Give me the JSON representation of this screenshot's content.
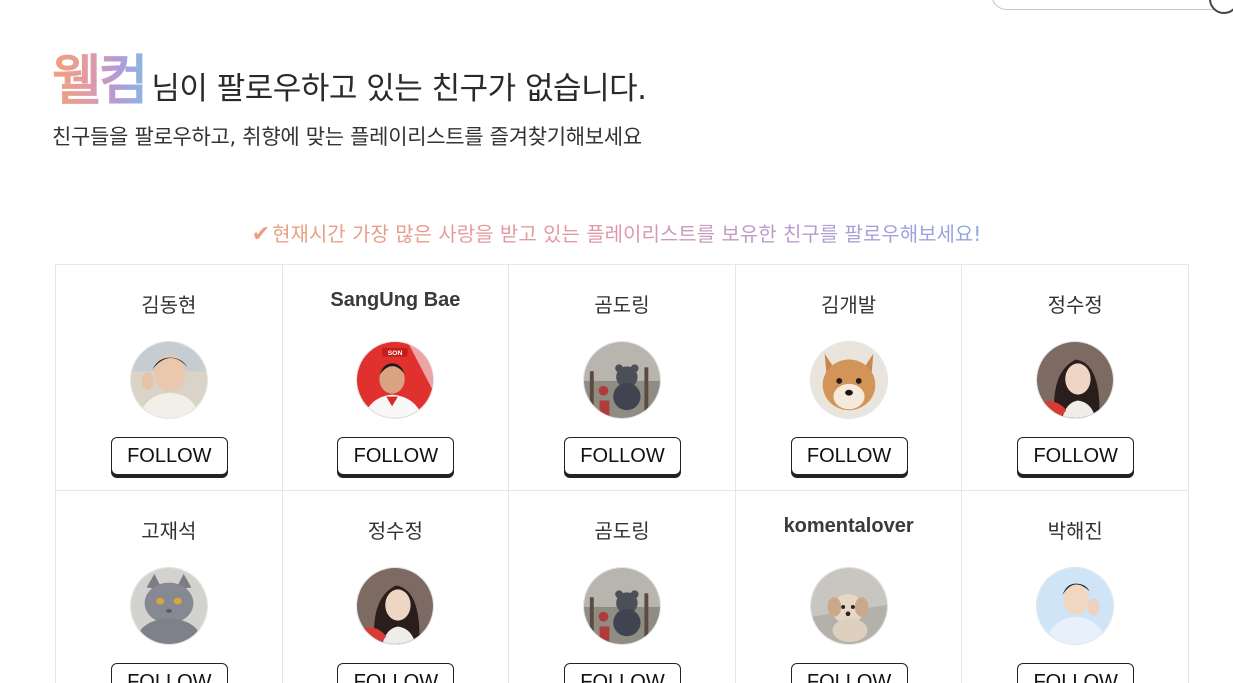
{
  "header": {
    "brand": "웰컴",
    "title_rest": "님이 팔로우하고 있는 친구가 없습니다.",
    "subtitle": "친구들을 팔로우하고, 취향에 맞는 플레이리스트를 즐겨찾기해보세요"
  },
  "recommend": {
    "check_icon": "✔",
    "text": "현재시간 가장 많은 사랑을 받고 있는 플레이리스트를 보유한 친구를 팔로우해보세요!"
  },
  "follow_label": "FOLLOW",
  "friends": [
    {
      "name": "김동현",
      "avatar": "person-photo"
    },
    {
      "name": "SangUng Bae",
      "avatar": "soccer-player-photo"
    },
    {
      "name": "곰도링",
      "avatar": "bear-doll-photo"
    },
    {
      "name": "김개발",
      "avatar": "shiba-dog-photo"
    },
    {
      "name": "정수정",
      "avatar": "woman-photo"
    },
    {
      "name": "고재석",
      "avatar": "gray-cat-photo"
    },
    {
      "name": "정수정",
      "avatar": "woman-photo"
    },
    {
      "name": "곰도링",
      "avatar": "bear-doll-photo"
    },
    {
      "name": "komentalover",
      "avatar": "small-dog-photo"
    },
    {
      "name": "박해진",
      "avatar": "man-photo"
    }
  ],
  "colors": {
    "brand_gradient": [
      "#f0a278",
      "#e29aa5",
      "#b39ad6",
      "#8ab7e3"
    ],
    "check": "#eba07c"
  }
}
